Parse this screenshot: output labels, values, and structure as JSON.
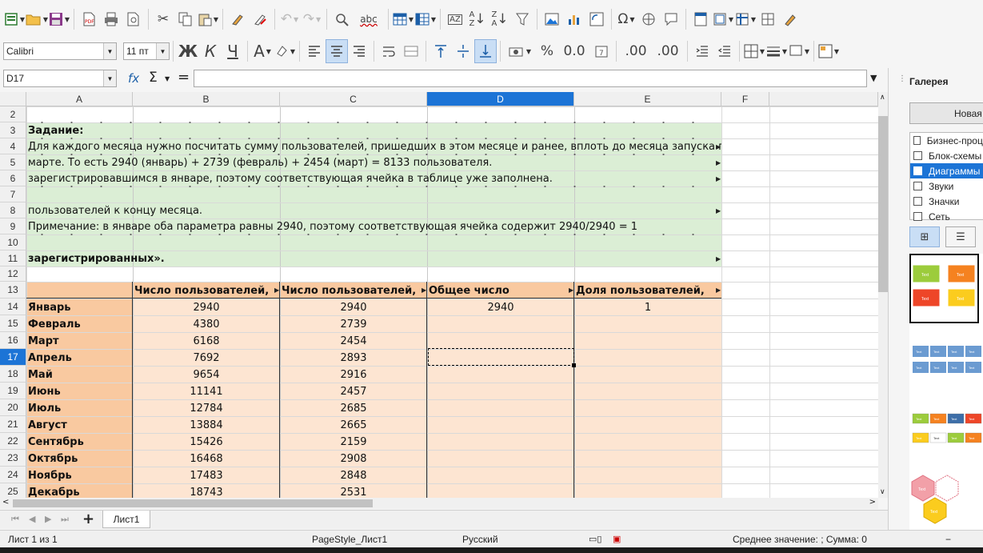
{
  "toolbar1": {
    "icons": [
      "new-icon",
      "open-icon",
      "save-icon",
      "export-pdf-icon",
      "print-icon",
      "print-preview-icon",
      "cut-icon",
      "copy-icon",
      "paste-icon",
      "clone-format-icon",
      "clear-format-icon",
      "undo-icon",
      "redo-icon",
      "find-replace-icon",
      "spelling-icon",
      "row-icon",
      "column-icon",
      "sort-icon",
      "sort-ascending-icon",
      "sort-descending-icon",
      "autofilter-icon",
      "image-icon",
      "chart-icon",
      "pivot-table-icon",
      "special-character-icon",
      "hyperlink-icon",
      "comment-icon",
      "headers-footers-icon",
      "define-print-area-icon",
      "freeze-icon",
      "split-window-icon",
      "show-draw-functions-icon"
    ],
    "spelling_label": "abc",
    "sort_label": "AZ",
    "omega_label": "Ω"
  },
  "toolbar2": {
    "font_name": "Calibri",
    "font_size": "11 пт",
    "bold_label": "Ж",
    "italic_label": "К",
    "underline_label": "Ч",
    "font_color_label": "А",
    "percent_label": "%",
    "decimal_label": "0.0",
    "add_decimal_label": ".00",
    "remove_decimal_label": ".00"
  },
  "formula_bar": {
    "name_box": "D17",
    "fx_label": "fx",
    "sigma_label": "Σ",
    "equals_label": "=",
    "formula_value": ""
  },
  "columns": [
    "A",
    "B",
    "C",
    "D",
    "E",
    "F"
  ],
  "selected_column": "D",
  "rows": [
    2,
    3,
    4,
    5,
    6,
    7,
    8,
    9,
    10,
    11,
    12,
    13,
    14,
    15,
    16,
    17,
    18,
    19,
    20,
    21,
    22,
    23,
    24,
    25
  ],
  "selected_row": 17,
  "task": {
    "title": "Задание:",
    "line4": "Для каждого месяца нужно посчитать сумму пользователей, пришедших в этом месяце и ранее, вплоть до месяца запуска приложения.",
    "line5": "марте. То есть 2940 (январь) + 2739 (февраль) + 2454 (март) = 8133 пользователя.",
    "line6": "зарегистрировавшимся в январе, поэтому соответствующая ячейка в таблице уже заполнена.",
    "line8": "пользователей к концу месяца.",
    "line9": "Примечание: в январе оба параметра равны 2940, поэтому соответствующая ячейка содержит 2940/2940 = 1",
    "line11": "зарегистрированных»."
  },
  "table": {
    "headers": [
      "",
      "Число пользователей,",
      "Число пользователей,",
      "Общее число",
      "Доля пользователей,"
    ],
    "rows": [
      {
        "month": "Январь",
        "b": "2940",
        "c": "2940",
        "d": "2940",
        "e": "1"
      },
      {
        "month": "Февраль",
        "b": "4380",
        "c": "2739",
        "d": "",
        "e": ""
      },
      {
        "month": "Март",
        "b": "6168",
        "c": "2454",
        "d": "",
        "e": ""
      },
      {
        "month": "Апрель",
        "b": "7692",
        "c": "2893",
        "d": "",
        "e": ""
      },
      {
        "month": "Май",
        "b": "9654",
        "c": "2916",
        "d": "",
        "e": ""
      },
      {
        "month": "Июнь",
        "b": "11141",
        "c": "2457",
        "d": "",
        "e": ""
      },
      {
        "month": "Июль",
        "b": "12784",
        "c": "2685",
        "d": "",
        "e": ""
      },
      {
        "month": "Август",
        "b": "13884",
        "c": "2665",
        "d": "",
        "e": ""
      },
      {
        "month": "Сентябрь",
        "b": "15426",
        "c": "2159",
        "d": "",
        "e": ""
      },
      {
        "month": "Октябрь",
        "b": "16468",
        "c": "2908",
        "d": "",
        "e": ""
      },
      {
        "month": "Ноябрь",
        "b": "17483",
        "c": "2848",
        "d": "",
        "e": ""
      },
      {
        "month": "Декабрь",
        "b": "18743",
        "c": "2531",
        "d": "",
        "e": ""
      }
    ]
  },
  "colors": {
    "task_band": "#dbeed5",
    "header_band": "#f9c9a0",
    "month_band": "#f9c9a0",
    "data_band": "#fde5d2",
    "selection": "#1c74d6"
  },
  "sheet_tabs": {
    "add_label": "+",
    "active_tab": "Лист1"
  },
  "status_bar": {
    "sheet_info": "Лист 1 из 1",
    "page_style": "PageStyle_Лист1",
    "language": "Русский",
    "summary": "Среднее значение: ; Сумма: 0",
    "zoom_minus": "−"
  },
  "sidebar": {
    "title": "Галерея",
    "new_theme_label": "Новая тема",
    "themes": [
      "Бизнес-процессы",
      "Блок-схемы",
      "Диаграммы",
      "Звуки",
      "Значки",
      "Сеть"
    ],
    "selected_theme": "Диаграммы",
    "preview_tile_label": "Text"
  }
}
